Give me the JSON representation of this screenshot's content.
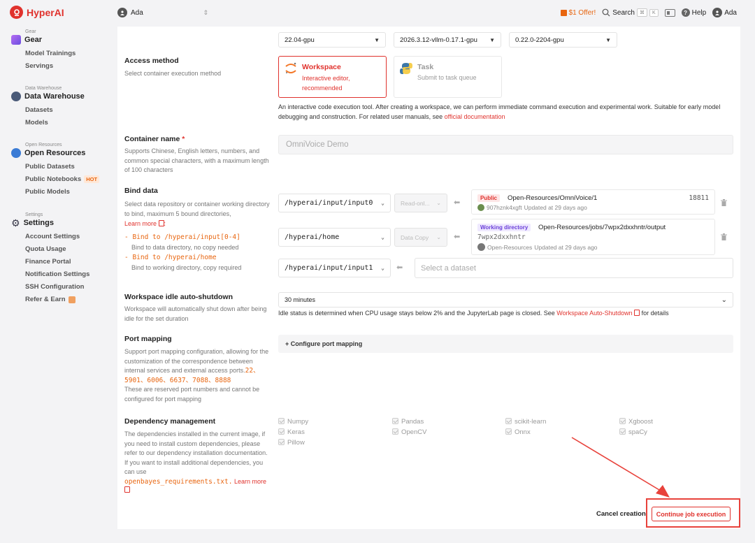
{
  "header": {
    "logo_text": "HyperAI",
    "user_switch": "Ada",
    "offer": "$1 Offer!",
    "search_label": "Search",
    "search_keys": [
      "⌘",
      "K"
    ],
    "help_label": "Help",
    "user_name": "Ada"
  },
  "sidebar": {
    "groups": [
      {
        "caption": "Gear",
        "title": "Gear",
        "items": [
          "Model Trainings",
          "Servings"
        ]
      },
      {
        "caption": "Data Warehouse",
        "title": "Data Warehouse",
        "items": [
          "Datasets",
          "Models"
        ]
      },
      {
        "caption": "Open Resources",
        "title": "Open Resources",
        "items": [
          "Public Datasets",
          "Public Notebooks",
          "Public Models"
        ],
        "hot": "HOT"
      },
      {
        "caption": "Settings",
        "title": "Settings",
        "items": [
          "Account Settings",
          "Quota Usage",
          "Finance Portal",
          "Notification Settings",
          "SSH Configuration",
          "Refer & Earn"
        ]
      }
    ]
  },
  "image_selects": [
    "22.04-gpu",
    "2026.3.12-vllm-0.17.1-gpu",
    "0.22.0-2204-gpu"
  ],
  "access": {
    "title": "Access method",
    "desc": "Select container execution method",
    "workspace_title": "Workspace",
    "workspace_desc": "Interactive editor, recommended",
    "task_title": "Task",
    "task_desc": "Submit to task queue",
    "note": "An interactive code execution tool. After creating a workspace, we can perform immediate command execution and experimental work. Suitable for early model debugging and construction. For related user manuals, see ",
    "note_link": "official documentation"
  },
  "container": {
    "title": "Container name",
    "required": "*",
    "desc": "Supports Chinese, English letters, numbers, and common special characters, with a maximum length of 100 characters",
    "value": "OmniVoice Demo"
  },
  "bind": {
    "title": "Bind data",
    "desc": "Select data repository or container working directory to bind, maximum 5 bound directories,",
    "learn_more": "Learn more",
    "rule1_code": "- Bind to /hyperai/input[0-4]",
    "rule1_desc": "Bind to data directory, no copy needed",
    "rule2_code": "- Bind to /hyperai/home",
    "rule2_desc": "Bind to working directory, copy required",
    "rows": [
      {
        "path": "/hyperai/input/input0",
        "mode": "Read-onl...",
        "badge": "Public",
        "name": "Open-Resources/OmniVoice/1",
        "count": "18811",
        "owner": "907hznk4xgft",
        "updated": "Updated at 29 days ago"
      },
      {
        "path": "/hyperai/home",
        "mode": "Data Copy",
        "badge": "Working directory",
        "name": "Open-Resources/jobs/7wpx2dxxhntr/output",
        "sub": "7wpx2dxxhntr",
        "owner": "Open-Resources",
        "updated": "Updated at 29 days ago"
      },
      {
        "path": "/hyperai/input/input1",
        "placeholder": "Select a dataset"
      }
    ]
  },
  "idle": {
    "title": "Workspace idle auto-shutdown",
    "desc": "Workspace will automatically shut down after being idle for the set duration",
    "value": "30 minutes",
    "note_pre": "Idle status is determined when CPU usage stays below 2% and the JupyterLab page is closed. See ",
    "note_link": "Workspace Auto-Shutdown",
    "note_post": " for details"
  },
  "ports": {
    "title": "Port mapping",
    "desc": "Support port mapping configuration, allowing for the customization of the correspondence between internal services and external access ports.",
    "reserved": "22、5901、6006、6637、7088、8888",
    "desc2": "These are reserved port numbers and cannot be configured for port mapping",
    "configure": "+ Configure port mapping"
  },
  "deps": {
    "title": "Dependency management",
    "desc": "The dependencies installed in the current image, if you need to install custom dependencies, please refer to our dependency installation documentation. If you want to install additional dependencies, you can use",
    "file": "openbayes_requirements.txt.",
    "learn_more": "Learn more",
    "items": [
      "Numpy",
      "Pandas",
      "scikit-learn",
      "Xgboost",
      "Keras",
      "OpenCV",
      "Onnx",
      "spaCy",
      "Pillow"
    ]
  },
  "footer": {
    "cancel": "Cancel creation",
    "continue": "Continue job execution"
  },
  "colors": {
    "accent": "#e0322d",
    "annotation": "#e8423b"
  }
}
